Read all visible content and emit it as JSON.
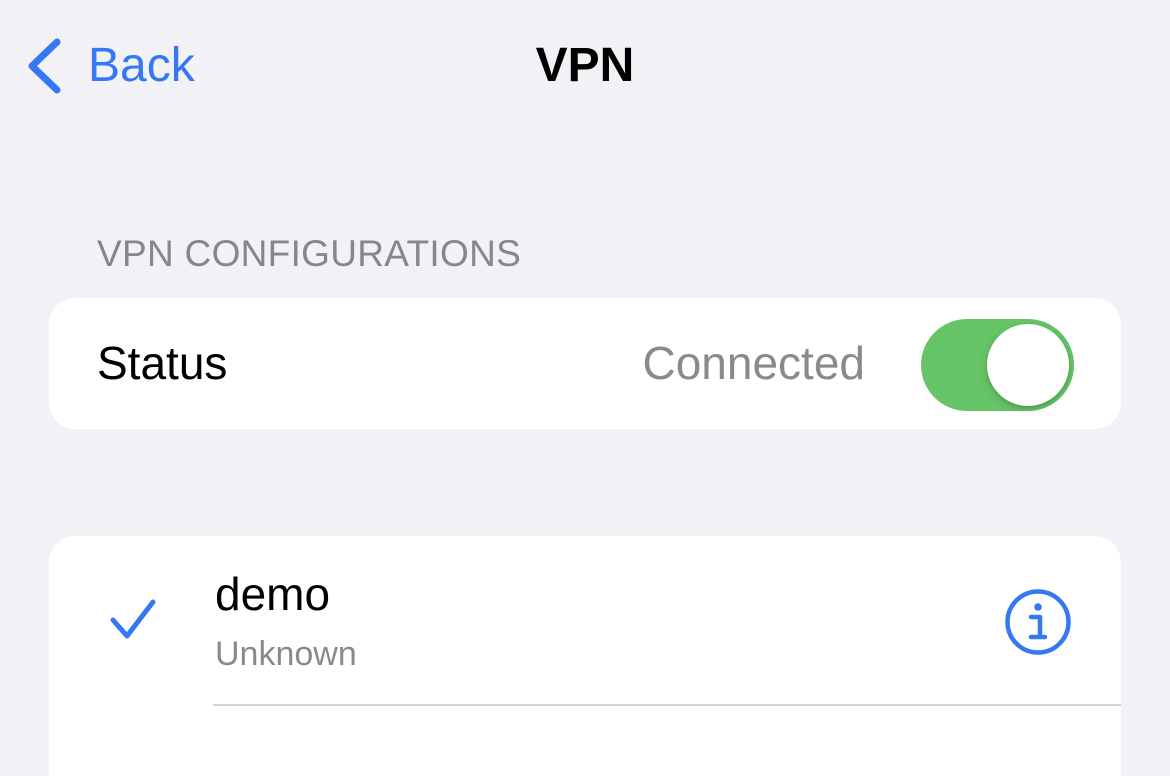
{
  "nav": {
    "back_label": "Back",
    "title": "VPN"
  },
  "section": {
    "header": "VPN CONFIGURATIONS"
  },
  "status": {
    "label": "Status",
    "value": "Connected",
    "toggle_on": true
  },
  "configurations": [
    {
      "name": "demo",
      "status": "Unknown",
      "selected": true
    }
  ],
  "colors": {
    "accent": "#3478f6",
    "toggle_on": "#65c466",
    "background": "#f1f1f6",
    "secondary_text": "#8a8a8e"
  },
  "icons": {
    "back": "chevron-left-icon",
    "selected": "checkmark-icon",
    "info": "info-circle-icon"
  }
}
